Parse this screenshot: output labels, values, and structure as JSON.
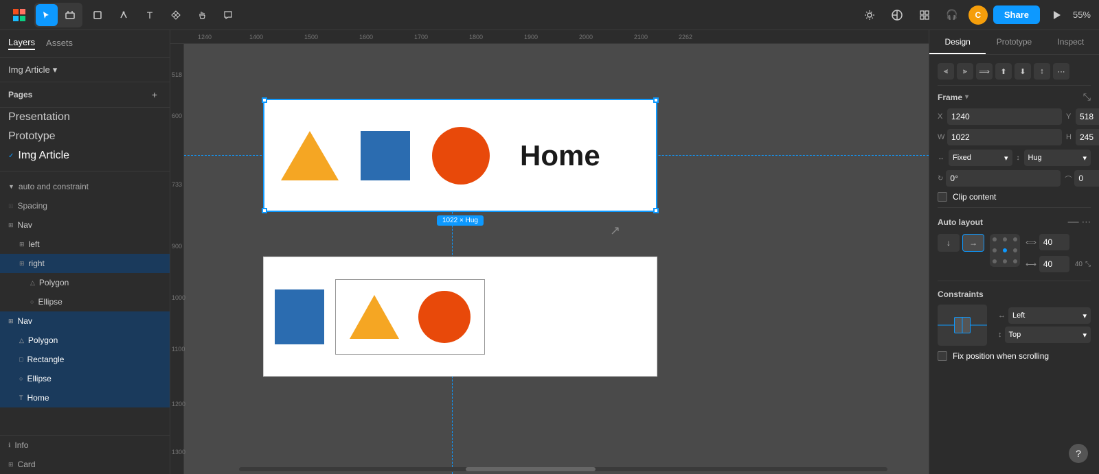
{
  "toolbar": {
    "zoom": "55%",
    "share_label": "Share",
    "avatar_initials": "C"
  },
  "left_panel": {
    "tabs": [
      {
        "id": "layers",
        "label": "Layers"
      },
      {
        "id": "assets",
        "label": "Assets"
      }
    ],
    "file_breadcrumb": "Img Article",
    "pages": [
      {
        "id": "presentation",
        "label": "Presentation",
        "active": false
      },
      {
        "id": "prototype",
        "label": "Prototype",
        "active": false
      },
      {
        "id": "img-article",
        "label": "Img Article",
        "active": true
      }
    ],
    "layers": [
      {
        "id": "auto-constraint",
        "label": "auto and constraint",
        "level": 1,
        "type": "section"
      },
      {
        "id": "spacing",
        "label": "Spacing",
        "level": 1,
        "type": "section"
      },
      {
        "id": "nav-1",
        "label": "Nav",
        "level": 1,
        "type": "nav"
      },
      {
        "id": "left",
        "label": "left",
        "level": 2,
        "type": "item"
      },
      {
        "id": "right",
        "label": "right",
        "level": 2,
        "type": "item",
        "selected": true
      },
      {
        "id": "polygon-1",
        "label": "Polygon",
        "level": 3,
        "type": "polygon"
      },
      {
        "id": "ellipse-1",
        "label": "Ellipse",
        "level": 3,
        "type": "ellipse"
      },
      {
        "id": "nav-2",
        "label": "Nav",
        "level": 1,
        "type": "nav",
        "selected": true
      },
      {
        "id": "polygon-2",
        "label": "Polygon",
        "level": 2,
        "type": "polygon"
      },
      {
        "id": "rectangle",
        "label": "Rectangle",
        "level": 2,
        "type": "rectangle"
      },
      {
        "id": "ellipse-2",
        "label": "Ellipse",
        "level": 2,
        "type": "ellipse"
      },
      {
        "id": "home",
        "label": "Home",
        "level": 2,
        "type": "text"
      }
    ],
    "bottom_sections": [
      {
        "id": "info",
        "label": "Info"
      },
      {
        "id": "card",
        "label": "Card"
      }
    ]
  },
  "canvas": {
    "frame_1_label": "1022 × Hug",
    "dashed_guide": true
  },
  "right_panel": {
    "tabs": [
      {
        "id": "design",
        "label": "Design"
      },
      {
        "id": "prototype",
        "label": "Prototype"
      },
      {
        "id": "inspect",
        "label": "Inspect"
      }
    ],
    "active_tab": "design",
    "frame_section": {
      "label": "Frame",
      "x": "1240",
      "y": "518",
      "w": "1022",
      "h": "245",
      "width_mode": "Fixed",
      "height_mode": "Hug",
      "rotation": "0°",
      "corner_radius": "0",
      "clip_content_label": "Clip content"
    },
    "auto_layout": {
      "label": "Auto layout",
      "direction": "horizontal",
      "gap_h": "40",
      "gap_v": "40",
      "padding": "40"
    },
    "constraints": {
      "label": "Constraints",
      "horizontal": "Left",
      "vertical": "Top"
    },
    "fix_scroll_label": "Fix position when scrolling"
  }
}
